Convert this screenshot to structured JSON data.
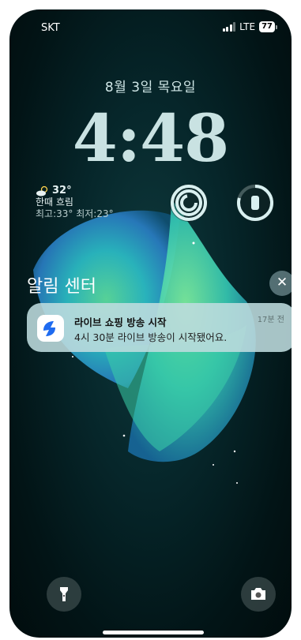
{
  "status_bar": {
    "carrier": "SKT",
    "network": "LTE",
    "battery": "77"
  },
  "lock": {
    "date": "8월 3일 목요일",
    "time": "4:48"
  },
  "weather": {
    "temp": "32°",
    "condition": "한때 흐림",
    "hilo": "최고:33° 최저:23°"
  },
  "widgets": {
    "activity": "activity-rings-icon",
    "watch": "watch-battery-icon"
  },
  "notification_center": {
    "title": "알림 센터"
  },
  "notification": {
    "title": "라이브 쇼핑 방송 시작",
    "body": "4시 30분 라이브 방송이 시작됐어요.",
    "time": "17분 전"
  },
  "colors": {
    "accent_ring": "#d9f0f0",
    "notif_bg": "#bedcde"
  }
}
